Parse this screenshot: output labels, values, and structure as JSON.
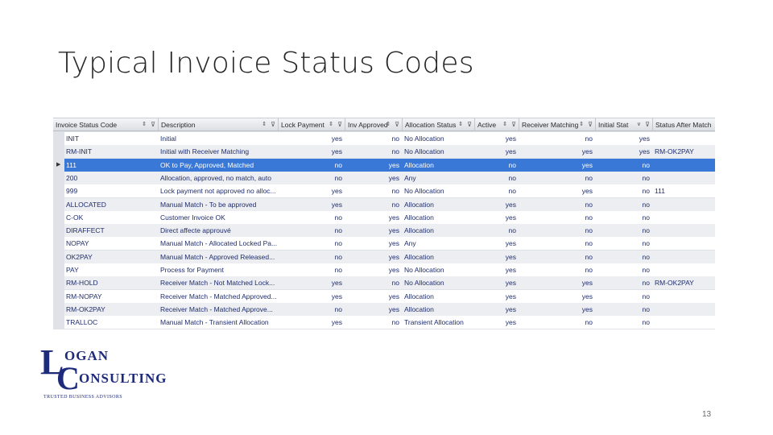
{
  "slide": {
    "title": "Typical Invoice Status Codes",
    "page_number": "13"
  },
  "grid": {
    "columns": [
      {
        "label": "Invoice Status Code",
        "sort": "⇕",
        "filter": "⊽"
      },
      {
        "label": "Description",
        "sort": "⇕",
        "filter": "⊽"
      },
      {
        "label": "Lock Payment",
        "sort": "⇕",
        "filter": "⊽"
      },
      {
        "label": "Inv Approved",
        "sort": "⇕",
        "filter": "⊽"
      },
      {
        "label": "Allocation Status",
        "sort": "⇕",
        "filter": "⊽"
      },
      {
        "label": "Active",
        "sort": "⇕",
        "filter": "⊽"
      },
      {
        "label": "Receiver Matching",
        "sort": "⇕",
        "filter": "⊽"
      },
      {
        "label": "Initial Stat",
        "sort": "∨",
        "filter": "⊽"
      },
      {
        "label": "Status After Match",
        "sort": "",
        "filter": ""
      }
    ],
    "selected_row_marker": "▶",
    "selected_index": 2,
    "rows": [
      [
        "INIT",
        "Initial",
        "yes",
        "no",
        "No Allocation",
        "yes",
        "no",
        "yes",
        ""
      ],
      [
        "RM-INIT",
        "Initial with Receiver Matching",
        "yes",
        "no",
        "No Allocation",
        "yes",
        "yes",
        "yes",
        "RM-OK2PAY"
      ],
      [
        "111",
        "OK to Pay, Approved, Matched",
        "no",
        "yes",
        "Allocation",
        "no",
        "yes",
        "no",
        ""
      ],
      [
        "200",
        "Allocation, approved, no match, auto",
        "no",
        "yes",
        "Any",
        "no",
        "no",
        "no",
        ""
      ],
      [
        "999",
        "Lock payment not approved no alloc...",
        "yes",
        "no",
        "No Allocation",
        "no",
        "yes",
        "no",
        "111"
      ],
      [
        "ALLOCATED",
        "Manual Match - To be approved",
        "yes",
        "no",
        "Allocation",
        "yes",
        "no",
        "no",
        ""
      ],
      [
        "C-OK",
        "Customer Invoice OK",
        "no",
        "yes",
        "Allocation",
        "yes",
        "no",
        "no",
        ""
      ],
      [
        "DIRAFFECT",
        "Direct affecte approuvé",
        "no",
        "yes",
        "Allocation",
        "no",
        "no",
        "no",
        ""
      ],
      [
        "NOPAY",
        "Manual Match - Allocated Locked Pa...",
        "no",
        "yes",
        "Any",
        "yes",
        "no",
        "no",
        ""
      ],
      [
        "OK2PAY",
        "Manual Match - Approved Released...",
        "no",
        "yes",
        "Allocation",
        "yes",
        "no",
        "no",
        ""
      ],
      [
        "PAY",
        "Process for Payment",
        "no",
        "yes",
        "No Allocation",
        "yes",
        "no",
        "no",
        ""
      ],
      [
        "RM-HOLD",
        "Receiver Match - Not Matched Lock...",
        "yes",
        "no",
        "No Allocation",
        "yes",
        "yes",
        "no",
        "RM-OK2PAY"
      ],
      [
        "RM-NOPAY",
        "Receiver Match - Matched Approved...",
        "yes",
        "yes",
        "Allocation",
        "yes",
        "yes",
        "no",
        ""
      ],
      [
        "RM-OK2PAY",
        "Receiver Match - Matched Approve...",
        "no",
        "yes",
        "Allocation",
        "yes",
        "yes",
        "no",
        ""
      ],
      [
        "TRALLOC",
        "Manual Match - Transient Allocation",
        "yes",
        "no",
        "Transient Allocation",
        "yes",
        "no",
        "no",
        ""
      ]
    ]
  },
  "logo": {
    "big_letter_1": "L",
    "word_1": "OGAN",
    "big_letter_2": "C",
    "word_2": "ONSULTING",
    "tagline": "TRUSTED BUSINESS ADVISORS",
    "color": "#1e2a7a"
  }
}
